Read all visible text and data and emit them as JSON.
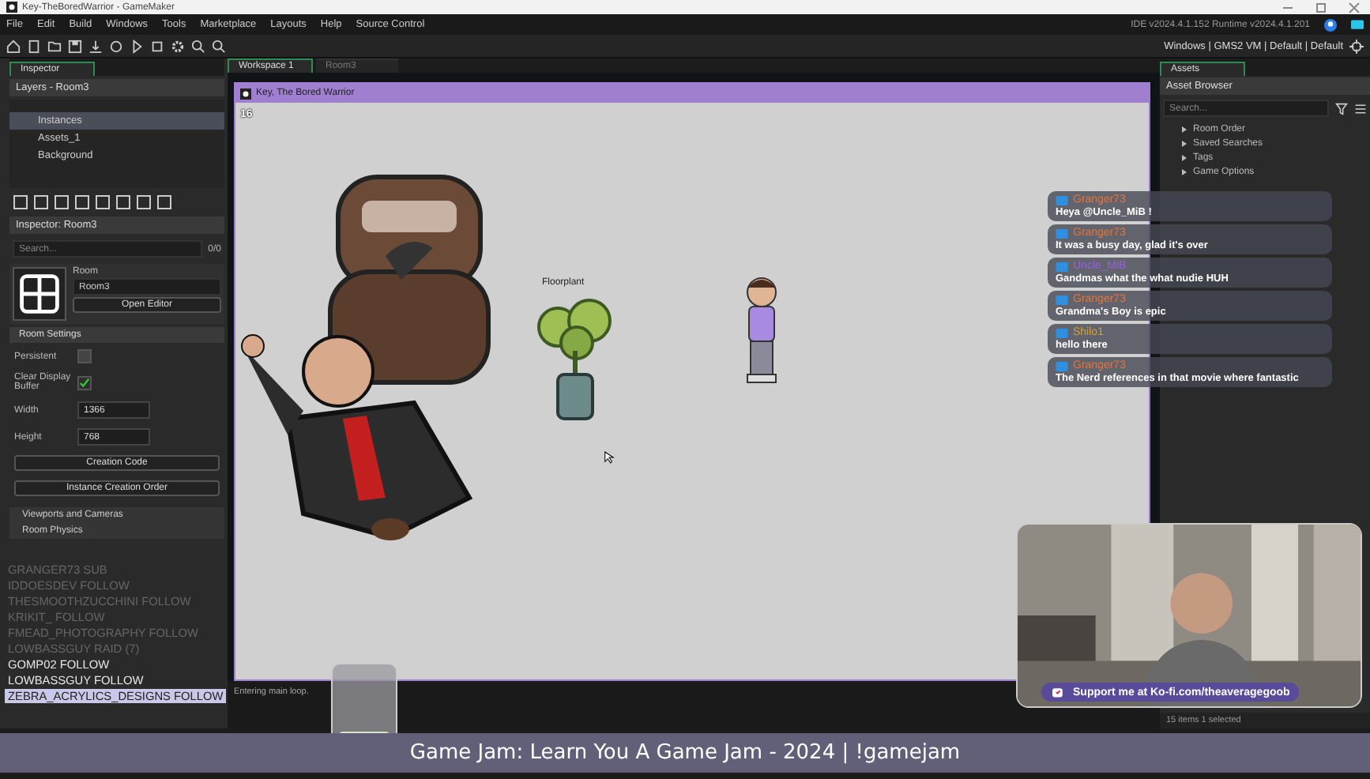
{
  "window": {
    "title": "Key-TheBoredWarrior - GameMaker",
    "version": "IDE v2024.4.1.152  Runtime v2024.4.1.201"
  },
  "menu": [
    "File",
    "Edit",
    "Build",
    "Windows",
    "Tools",
    "Marketplace",
    "Layouts",
    "Help",
    "Source Control"
  ],
  "targets": "Windows | GMS2 VM | Default | Default",
  "left_tab": "Inspector",
  "layers": {
    "title": "Layers - Room3",
    "items": [
      {
        "name": "Instances",
        "selected": true
      },
      {
        "name": "Assets_1",
        "selected": false
      },
      {
        "name": "Background",
        "selected": false
      }
    ]
  },
  "inspector": {
    "title": "Inspector: Room3",
    "search_placeholder": "Search...",
    "count": "0/0",
    "room_label": "Room",
    "room_name": "Room3",
    "open_editor": "Open Editor",
    "section": "Room Settings",
    "checks": [
      {
        "label": "Persistent",
        "checked": false
      },
      {
        "label": "Clear Display Buffer",
        "checked": true
      }
    ],
    "fields": [
      {
        "label": "Width",
        "value": "1366"
      },
      {
        "label": "Height",
        "value": "768"
      }
    ],
    "buttons": [
      "Creation Code",
      "Instance Creation Order"
    ],
    "groups": [
      "Viewports and Cameras",
      "Room Physics"
    ]
  },
  "center_tabs": [
    {
      "label": "Workspace 1",
      "selected": true
    },
    {
      "label": "Room3",
      "selected": false
    }
  ],
  "game_window": {
    "title": "Key, The Bored Warrior",
    "fps": "16",
    "nameplate": "Floorplant"
  },
  "output": "Entering main loop.",
  "assets": {
    "tab": "Assets",
    "title": "Asset Browser",
    "search_placeholder": "Search...",
    "status": "15 items   1 selected",
    "tree": [
      {
        "label": "Room Order",
        "expanded": false
      },
      {
        "label": "Saved Searches",
        "expanded": false
      },
      {
        "label": "Tags",
        "expanded": false
      },
      {
        "label": "Game Options",
        "expanded": false
      }
    ]
  },
  "chat": [
    {
      "user": "Granger73",
      "color": "#e8743a",
      "message": "Heya @Uncle_MiB !"
    },
    {
      "user": "Granger73",
      "color": "#e8743a",
      "message": "It was a busy day, glad it's over"
    },
    {
      "user": "Uncle_MiB",
      "color": "#9b5de5",
      "message": "Gandmas what the what nudie HUH"
    },
    {
      "user": "Granger73",
      "color": "#e8743a",
      "message": "Grandma's Boy is epic"
    },
    {
      "user": "Shilo1",
      "color": "#d9a030",
      "message": "hello there"
    },
    {
      "user": "Granger73",
      "color": "#e8743a",
      "message": "The Nerd references in that movie where fantastic"
    }
  ],
  "events": [
    {
      "text": "GRANGER73  SUB",
      "faded": true,
      "selected": false
    },
    {
      "text": "IDDOESDEV  FOLLOW",
      "faded": true,
      "selected": false
    },
    {
      "text": "THESMOOTHZUCCHINI  FOLLOW",
      "faded": true,
      "selected": false
    },
    {
      "text": "KRIKIT_  FOLLOW",
      "faded": true,
      "selected": false
    },
    {
      "text": "FMEAD_PHOTOGRAPHY  FOLLOW",
      "faded": true,
      "selected": false
    },
    {
      "text": "LOWBASSGUY  RAID (7)",
      "faded": true,
      "selected": false
    },
    {
      "text": "GOMP02  FOLLOW",
      "faded": false,
      "selected": false
    },
    {
      "text": "LOWBASSGUY  FOLLOW",
      "faded": false,
      "selected": false
    },
    {
      "text": "ZEBRA_ACRYLICS_DESIGNS  FOLLOW",
      "faded": false,
      "selected": true
    }
  ],
  "webcam": {
    "support": "Support me at Ko-fi.com/theaveragegoob"
  },
  "banner": "Game Jam: Learn You A Game Jam - 2024 | !gamejam"
}
